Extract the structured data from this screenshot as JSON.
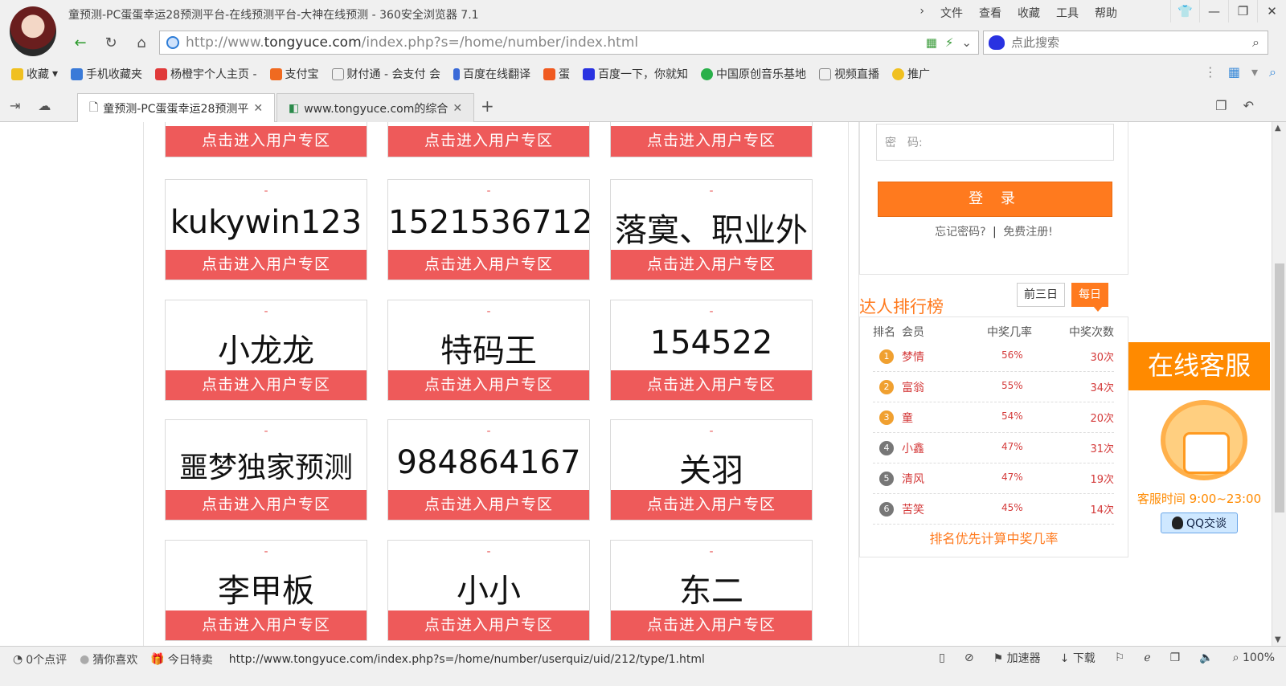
{
  "window": {
    "title": "童预测-PC蛋蛋幸运28预测平台-在线预测平台-大神在线预测 - 360安全浏览器 7.1",
    "menu": [
      "文件",
      "查看",
      "收藏",
      "工具",
      "帮助"
    ]
  },
  "address": {
    "prefix": "http://www.",
    "domain": "tongyuce.com",
    "path": "/index.php?s=/home/number/index.html"
  },
  "search": {
    "placeholder": "点此搜索"
  },
  "bookmarks": [
    "收藏",
    "手机收藏夹",
    "杨橙宇个人主页 -",
    "支付宝",
    "财付通 - 会支付 会",
    "百度在线翻译",
    "蛋",
    "百度一下，你就知",
    "中国原创音乐基地",
    "视频直播",
    "推广"
  ],
  "tabs": [
    {
      "label": "童预测-PC蛋蛋幸运28预测平"
    },
    {
      "label": "www.tongyuce.com的综合"
    }
  ],
  "cards": {
    "enter_label": "点击进入用户专区",
    "dash": "-",
    "rows": [
      [
        "kukywin123",
        "1521536712",
        "落寞、职业外"
      ],
      [
        "小龙龙",
        "特码王",
        "154522"
      ],
      [
        "噩梦独家预测",
        "984864167",
        "关羽"
      ],
      [
        "李甲板",
        "小小",
        "东二"
      ]
    ]
  },
  "login": {
    "password_label": "密　码:",
    "button": "登 录",
    "forgot": "忘记密码?",
    "sep": "|",
    "register": "免费注册!"
  },
  "ranking": {
    "title": "达人排行榜",
    "tab_3days": "前三日",
    "tab_daily": "每日",
    "head": {
      "rank": "排名",
      "member": "会员",
      "rate": "中奖几率",
      "count": "中奖次数"
    },
    "rows": [
      {
        "n": "1",
        "name": "梦情",
        "rate": "56%",
        "count": "30次",
        "color": "#f0a030"
      },
      {
        "n": "2",
        "name": "富翁",
        "rate": "55%",
        "count": "34次",
        "color": "#f0a030"
      },
      {
        "n": "3",
        "name": "童",
        "rate": "54%",
        "count": "20次",
        "color": "#f0a030"
      },
      {
        "n": "4",
        "name": "小鑫",
        "rate": "47%",
        "count": "31次",
        "color": "#777777"
      },
      {
        "n": "5",
        "name": "清风",
        "rate": "47%",
        "count": "19次",
        "color": "#777777"
      },
      {
        "n": "6",
        "name": "苦笑",
        "rate": "45%",
        "count": "14次",
        "color": "#777777"
      }
    ],
    "note": "排名优先计算中奖几率"
  },
  "kefu": {
    "title": "在线客服",
    "time": "客服时间  9:00~23:00",
    "qq": "QQ交谈"
  },
  "status": {
    "comments": "0个点评",
    "guess": "猜你喜欢",
    "deals": "今日特卖",
    "url": "http://www.tongyuce.com/index.php?s=/home/number/userquiz/uid/212/type/1.html",
    "accelerator": "加速器",
    "download": "下载",
    "zoom": "100%"
  }
}
